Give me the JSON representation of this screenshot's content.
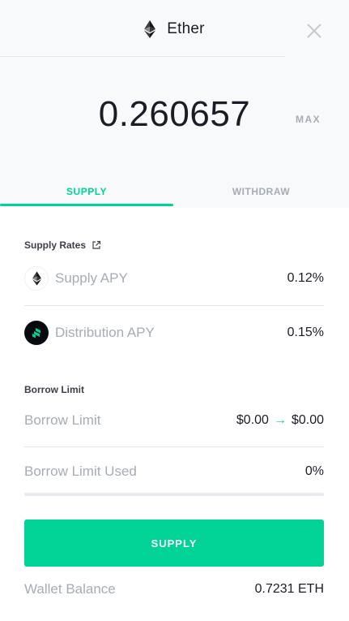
{
  "header": {
    "title": "Ether",
    "icon": "ether-icon",
    "close_icon": "close-icon"
  },
  "amount": {
    "value": "0.260657",
    "max_label": "MAX"
  },
  "tabs": [
    {
      "label": "SUPPLY",
      "active": true
    },
    {
      "label": "WITHDRAW",
      "active": false
    }
  ],
  "supply_rates": {
    "title": "Supply Rates",
    "link_icon": "external-link-icon",
    "rows": [
      {
        "icon": "ether-icon",
        "label": "Supply APY",
        "value": "0.12%"
      },
      {
        "icon": "compound-icon",
        "label": "Distribution APY",
        "value": "0.15%"
      }
    ]
  },
  "borrow_limit": {
    "title": "Borrow Limit",
    "limit_label": "Borrow Limit",
    "limit_from": "$0.00",
    "limit_to": "$0.00",
    "arrow": "→",
    "used_label": "Borrow Limit Used",
    "used_value": "0%",
    "used_fraction": 0
  },
  "action": {
    "label": "SUPPLY"
  },
  "wallet": {
    "label": "Wallet Balance",
    "value": "0.7231 ETH"
  },
  "colors": {
    "accent": "#00d395",
    "muted": "#a6acb5",
    "text": "#1c1c26"
  }
}
